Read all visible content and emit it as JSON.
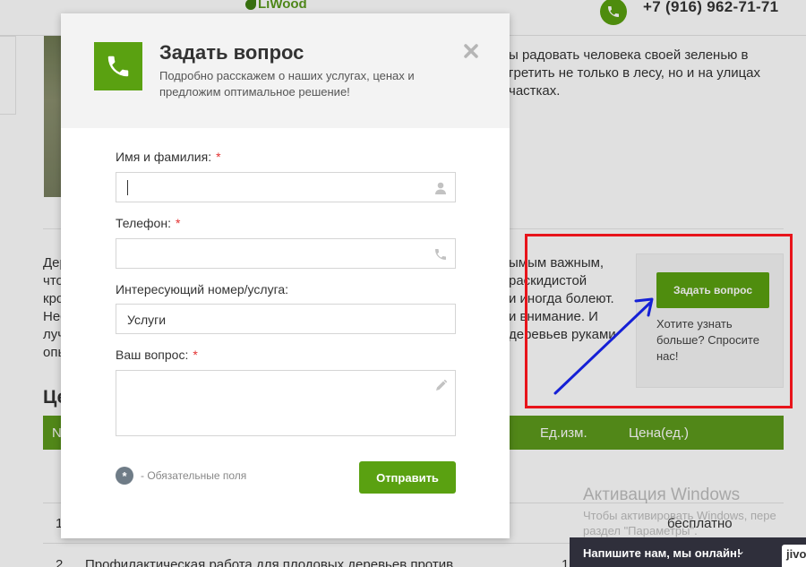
{
  "header": {
    "logo_text": "LiWood",
    "phone_number": "+7 (916) 962-71-71"
  },
  "background": {
    "intro_lines": [
      "ы радовать человека своей зеленью в",
      "гретить не только в лесу, но и на улицах",
      "частках."
    ],
    "para_left_lines": [
      "Дер",
      "что",
      "кро",
      "Нес",
      "луч",
      "опь"
    ],
    "para_right_lines": [
      "ымым важным,",
      "раскидистой",
      "и иногда болеют.",
      "и внимание. И",
      "деревьев руками"
    ],
    "section_heading": "Це",
    "table_headers": {
      "num": "N",
      "unit": "Ед.изм.",
      "price": "Цена(ед.)"
    },
    "rows": [
      {
        "num": "1",
        "price": "бесплатно",
        "name": ""
      },
      {
        "num": "2",
        "name": "Профилактическая работа для плодовых деревьев против",
        "unit": "1"
      }
    ]
  },
  "widget": {
    "button_label": "Задать вопрос",
    "text": "Хотите узнать больше? Спросите нас!"
  },
  "modal": {
    "title": "Задать вопрос",
    "subtitle": "Подробно расскажем о наших услугах, ценах и предложим оптимальное решение!",
    "fields": {
      "name": {
        "label": "Имя и фамилия:",
        "required": "*",
        "value": ""
      },
      "phone": {
        "label": "Телефон:",
        "required": "*",
        "value": ""
      },
      "service": {
        "label": "Интересующий номер/услуга:",
        "value": "Услуги"
      },
      "question": {
        "label": "Ваш вопрос:",
        "required": "*",
        "value": ""
      }
    },
    "required_note": "- Обязательные поля",
    "required_marker": "*",
    "submit_label": "Отправить"
  },
  "windows": {
    "watermark_title": "Активация Windows",
    "watermark_line1": "Чтобы активировать Windows, пере",
    "watermark_line2": "раздел \"Параметры\"."
  },
  "chat": {
    "label": "Напишите нам, мы онлайн!",
    "brand": "jivo"
  },
  "colors": {
    "accent_green": "#5aa111",
    "required_red": "#e33232",
    "annotation_red": "#e8141b",
    "annotation_blue": "#1520d6"
  }
}
